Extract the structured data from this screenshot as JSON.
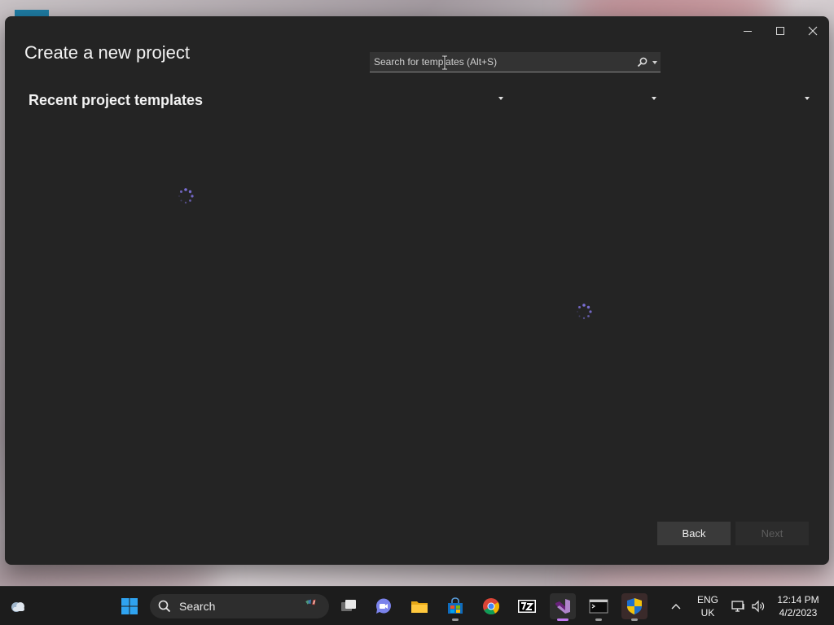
{
  "dialog": {
    "title": "Create a new project",
    "recent_heading": "Recent project templates",
    "search": {
      "placeholder": "Search for templates (Alt+S)"
    },
    "filters": [
      {
        "value": ""
      },
      {
        "value": ""
      },
      {
        "value": ""
      }
    ],
    "buttons": {
      "back": "Back",
      "next": "Next"
    }
  },
  "taskbar": {
    "search_label": "Search",
    "apps": [
      "weather-icon",
      "start-icon",
      "task-view-icon",
      "teams-icon",
      "file-explorer-icon",
      "store-icon",
      "chrome-icon",
      "7zip-icon",
      "visual-studio-icon",
      "terminal-icon",
      "security-shield-icon"
    ],
    "language": {
      "line1": "ENG",
      "line2": "UK"
    },
    "clock": {
      "time": "12:14 PM",
      "date": "4/2/2023"
    },
    "colors": {
      "accent": "#c27af0",
      "spinner": "#7b6fd6"
    }
  }
}
